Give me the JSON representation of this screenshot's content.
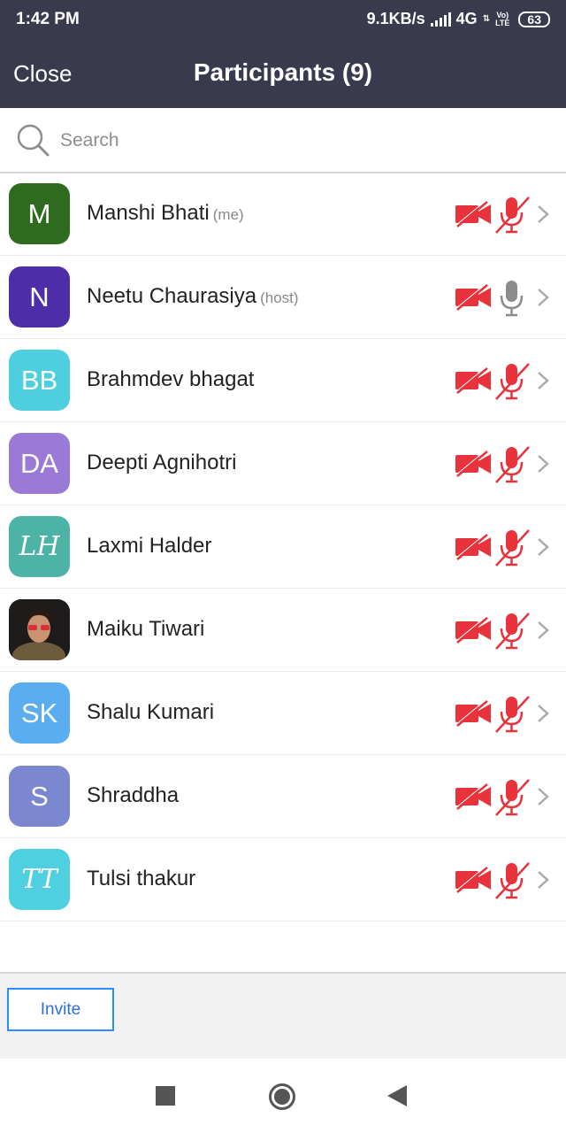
{
  "status_bar": {
    "time": "1:42 PM",
    "speed": "9.1KB/s",
    "network": "4G",
    "network_sub": "⇅",
    "lte_top": "Vo)",
    "lte_bottom": "LTE",
    "battery": "63"
  },
  "nav": {
    "close_label": "Close",
    "title": "Participants (9)"
  },
  "search": {
    "placeholder": "Search"
  },
  "participants": [
    {
      "name": "Manshi Bhati",
      "tag": "(me)",
      "initials": "M",
      "avatar_color": "#2e6b1f",
      "video": "off",
      "mic": "muted"
    },
    {
      "name": "Neetu Chaurasiya",
      "tag": "(host)",
      "initials": "N",
      "avatar_color": "#4e2ea8",
      "video": "off",
      "mic": "unmuted"
    },
    {
      "name": "Brahmdev bhagat",
      "tag": "",
      "initials": "BB",
      "avatar_color": "#4dcfe0",
      "video": "off",
      "mic": "muted"
    },
    {
      "name": "Deepti Agnihotri",
      "tag": "",
      "initials": "DA",
      "avatar_color": "#9a7ad6",
      "video": "off",
      "mic": "muted"
    },
    {
      "name": "Laxmi Halder",
      "tag": "",
      "initials": "LH",
      "avatar_color": "#4db3a6",
      "video": "off",
      "mic": "muted"
    },
    {
      "name": "Maiku Tiwari",
      "tag": "",
      "initials": "",
      "avatar_color": "#2b2b2b",
      "video": "off",
      "mic": "muted"
    },
    {
      "name": "Shalu Kumari",
      "tag": "",
      "initials": "SK",
      "avatar_color": "#5aaef0",
      "video": "off",
      "mic": "muted"
    },
    {
      "name": "Shraddha",
      "tag": "",
      "initials": "S",
      "avatar_color": "#7b87cf",
      "video": "off",
      "mic": "muted"
    },
    {
      "name": "Tulsi thakur",
      "tag": "",
      "initials": "TT",
      "avatar_color": "#4fd0e0",
      "video": "off",
      "mic": "muted"
    }
  ],
  "bottom": {
    "invite_label": "Invite"
  },
  "colors": {
    "header_bg": "#3a3a4e",
    "muted_red": "#e8323c",
    "unmuted_gray": "#8c8c8c",
    "invite_blue": "#2d8cff"
  }
}
